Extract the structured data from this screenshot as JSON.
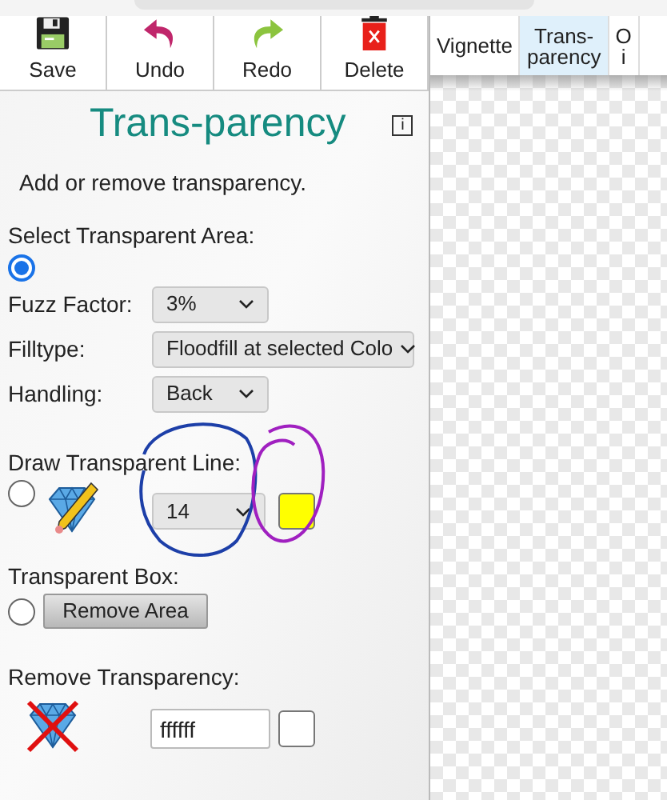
{
  "toolbar": [
    {
      "label": "Save",
      "kind": "save"
    },
    {
      "label": "Undo",
      "kind": "undo"
    },
    {
      "label": "Redo",
      "kind": "redo"
    },
    {
      "label": "Delete",
      "kind": "delete"
    }
  ],
  "tabs": [
    {
      "label": "Vignette",
      "selected": false
    },
    {
      "label": "Trans-\nparency",
      "selected": true
    },
    {
      "label": "O\ni",
      "selected": false
    }
  ],
  "panel": {
    "title": "Trans-parency",
    "info": "i",
    "description": "Add or remove transparency.",
    "select_area": {
      "label": "Select Transparent Area:",
      "selected": true,
      "fields": [
        {
          "label": "Fuzz Factor:",
          "value": "3%",
          "wide": false
        },
        {
          "label": "Filltype:",
          "value": "Floodfill at selected Colo",
          "wide": true
        },
        {
          "label": "Handling:",
          "value": "Back",
          "wide": false
        }
      ]
    },
    "draw_line": {
      "label": "Draw Transparent Line:",
      "selected": false,
      "size": "14",
      "color": "#ffff00"
    },
    "box": {
      "label": "Transparent Box:",
      "selected": false,
      "button": "Remove Area"
    },
    "remove": {
      "label": "Remove Transparency:",
      "value": "ffffff",
      "color": "#ffffff"
    }
  }
}
